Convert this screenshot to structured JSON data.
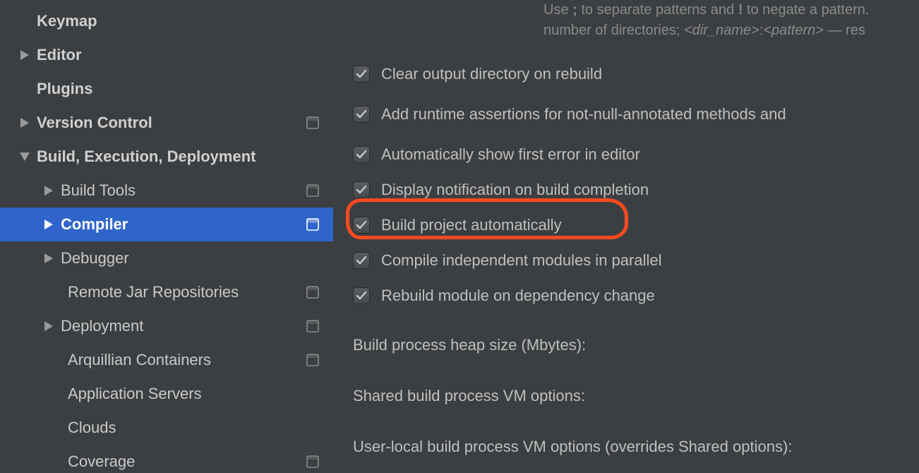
{
  "sidebar": {
    "keymap": "Keymap",
    "editor": "Editor",
    "plugins": "Plugins",
    "version_control": "Version Control",
    "bed": "Build, Execution, Deployment",
    "build_tools": "Build Tools",
    "compiler": "Compiler",
    "debugger": "Debugger",
    "remote_jar": "Remote Jar Repositories",
    "deployment": "Deployment",
    "arquillian": "Arquillian Containers",
    "app_servers": "Application Servers",
    "clouds": "Clouds",
    "coverage": "Coverage"
  },
  "hint": {
    "line1a": "Use ",
    "line1b": " to separate patterns and ",
    "line1c": " to negate a pattern.",
    "semicolon": ";",
    "bang": "!",
    "line2a": "number of directories; ",
    "dirname": "<dir_name>",
    "colon": ":",
    "pattern": "<pattern>",
    "line2b": " — res"
  },
  "checks": {
    "clear_output": "Clear output directory on rebuild",
    "runtime_assert": "Add runtime assertions for not-null-annotated methods and ",
    "show_error": "Automatically show first error in editor",
    "notify_build": "Display notification on build completion",
    "build_auto": "Build project automatically",
    "compile_parallel": "Compile independent modules in parallel",
    "rebuild_dep": "Rebuild module on dependency change"
  },
  "fields": {
    "heap": "Build process heap size (Mbytes):",
    "shared_vm": "Shared build process VM options:",
    "user_vm": "User-local build process VM options (overrides Shared options):"
  }
}
